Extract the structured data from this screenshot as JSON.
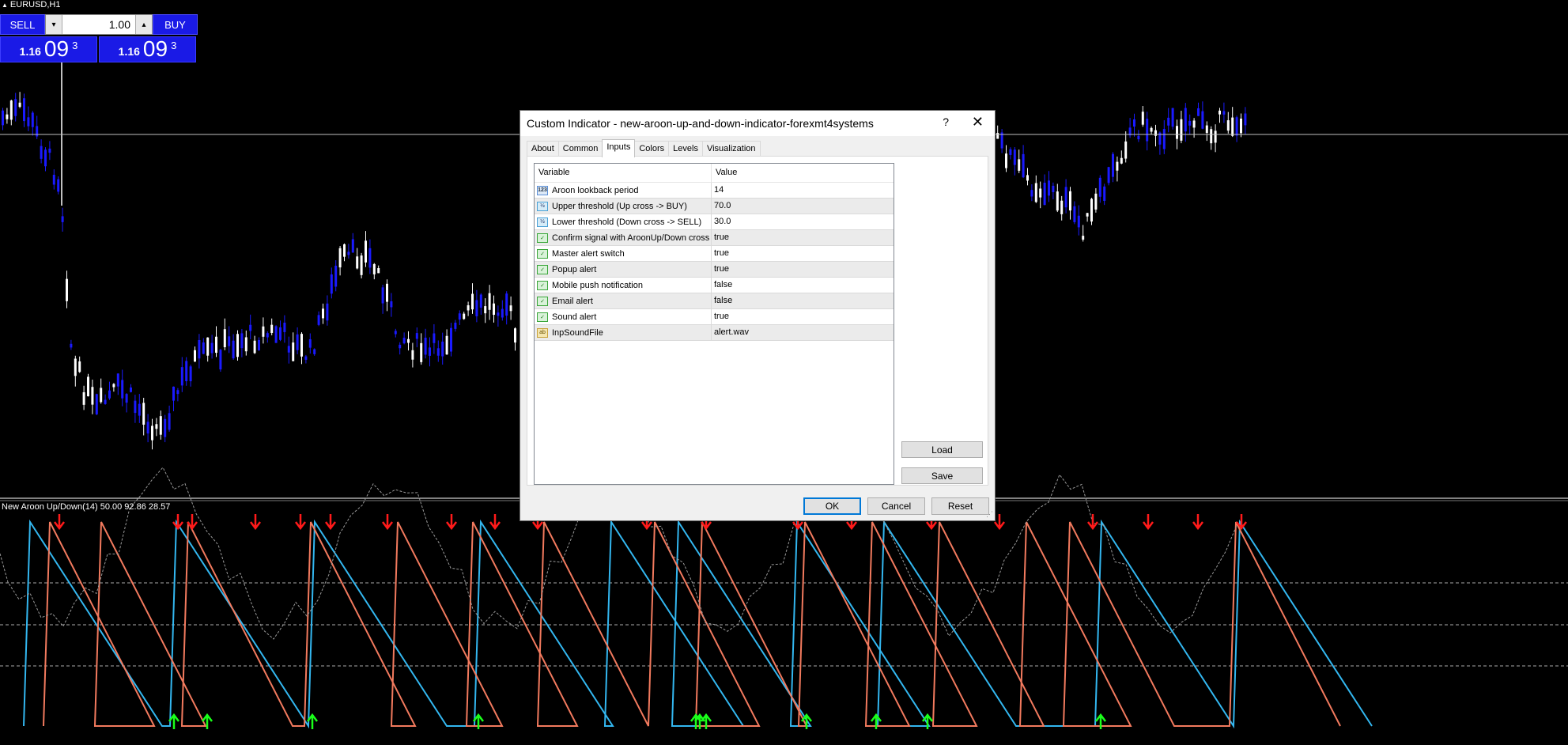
{
  "chart": {
    "symbol": "EURUSD,H1",
    "indicator_label": "New Aroon Up/Down(14) 50.00 92.86 28.57"
  },
  "trade_panel": {
    "sell_label": "SELL",
    "buy_label": "BUY",
    "lot_value": "1.00",
    "lot_down_icon": "▾",
    "lot_up_icon": "▴",
    "sell_price": {
      "prefix": "1.16",
      "big": "09",
      "sup": "3"
    },
    "buy_price": {
      "prefix": "1.16",
      "big": "09",
      "sup": "3"
    }
  },
  "dialog": {
    "title": "Custom Indicator - new-aroon-up-and-down-indicator-forexmt4systems",
    "help": "?",
    "close": "✕",
    "tabs": [
      "About",
      "Common",
      "Inputs",
      "Colors",
      "Levels",
      "Visualization"
    ],
    "active_tab": "Inputs",
    "columns": {
      "variable": "Variable",
      "value": "Value"
    },
    "rows": [
      {
        "icon": "123",
        "type": "int",
        "variable": "Aroon lookback period",
        "value": "14"
      },
      {
        "icon": "½",
        "type": "double",
        "variable": "Upper threshold (Up cross -> BUY)",
        "value": "70.0"
      },
      {
        "icon": "½",
        "type": "double",
        "variable": "Lower threshold (Down cross -> SELL)",
        "value": "30.0"
      },
      {
        "icon": "✓",
        "type": "bool",
        "variable": "Confirm signal with AroonUp/Down cross",
        "value": "true"
      },
      {
        "icon": "✓",
        "type": "bool",
        "variable": "Master alert switch",
        "value": "true"
      },
      {
        "icon": "✓",
        "type": "bool",
        "variable": "Popup alert",
        "value": "true"
      },
      {
        "icon": "✓",
        "type": "bool",
        "variable": "Mobile push notification",
        "value": "false"
      },
      {
        "icon": "✓",
        "type": "bool",
        "variable": "Email alert",
        "value": "false"
      },
      {
        "icon": "✓",
        "type": "bool",
        "variable": "Sound alert",
        "value": "true"
      },
      {
        "icon": "ab",
        "type": "string",
        "variable": "InpSoundFile",
        "value": "alert.wav"
      }
    ],
    "buttons": {
      "load": "Load",
      "save": "Save",
      "ok": "OK",
      "cancel": "Cancel",
      "reset": "Reset"
    }
  },
  "colors": {
    "bull_candle": "#ffffff",
    "bear_candle": "#1a1aff",
    "aroon_up": "#33b7f0",
    "aroon_down": "#f27a5e",
    "sell_arrow": "#ff1a1a",
    "buy_arrow": "#1aff1a",
    "panel_blue": "#1a1ae6"
  }
}
